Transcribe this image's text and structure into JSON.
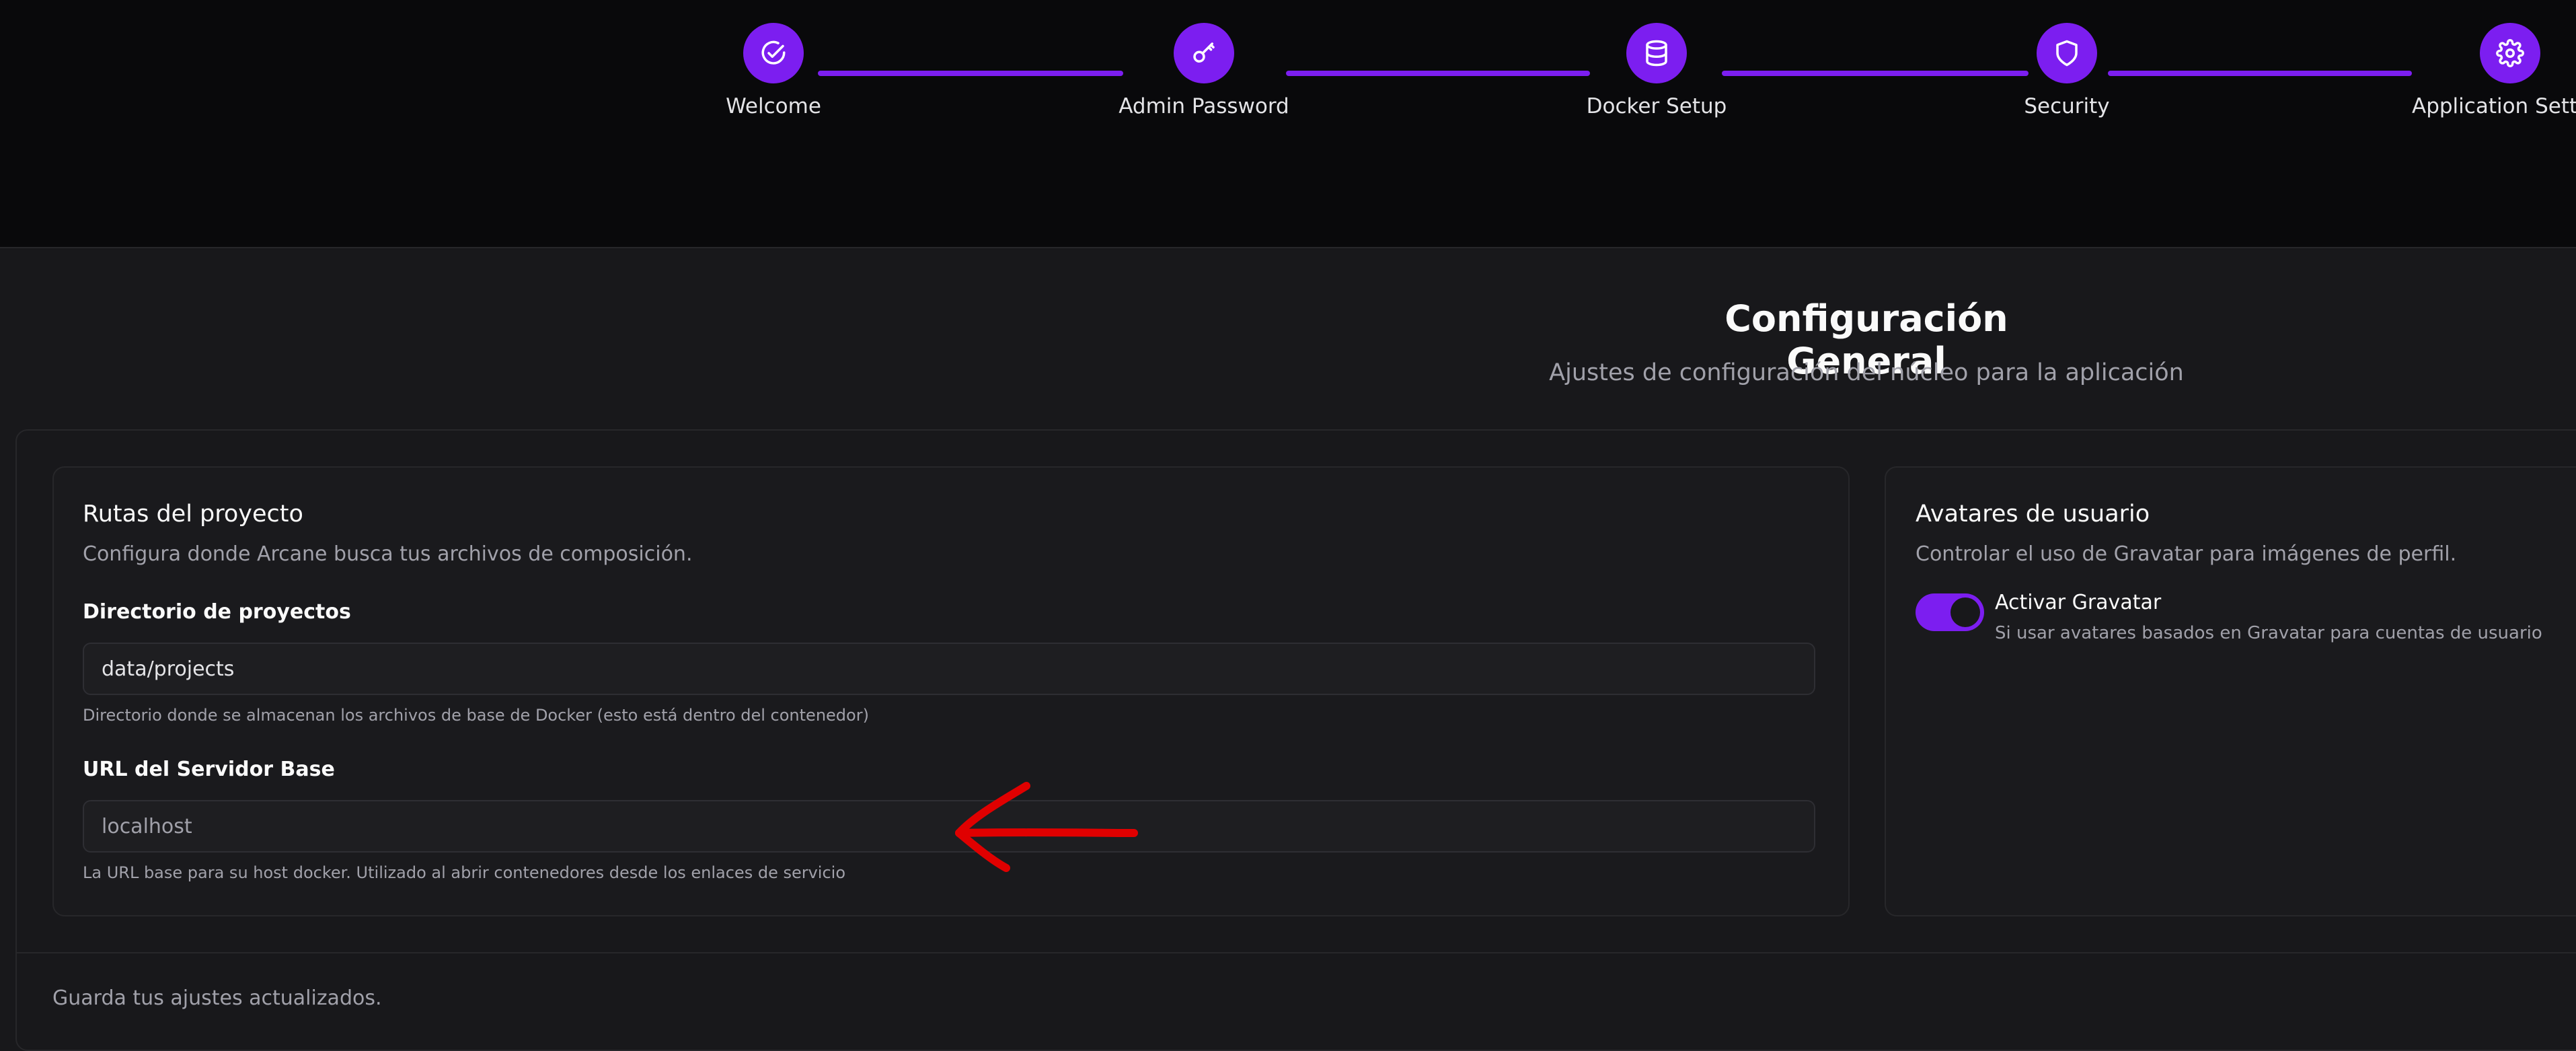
{
  "stepper": {
    "steps": [
      {
        "label": "Welcome",
        "icon": "circle-check-icon"
      },
      {
        "label": "Admin Password",
        "icon": "key-icon"
      },
      {
        "label": "Docker Setup",
        "icon": "database-icon"
      },
      {
        "label": "Security",
        "icon": "shield-icon"
      },
      {
        "label": "Application Settings",
        "icon": "gear-icon"
      }
    ],
    "accent": "#7c1ef0"
  },
  "header": {
    "title": "Configuración General",
    "subtitle": "Ajustes de configuración del núcleo para la aplicación"
  },
  "project_paths": {
    "title": "Rutas del proyecto",
    "description": "Configura donde Arcane busca tus archivos de composición.",
    "projects_dir": {
      "label": "Directorio de proyectos",
      "value": "data/projects",
      "help": "Directorio donde se almacenan los archivos de base de Docker (esto está dentro del contenedor)"
    },
    "base_url": {
      "label": "URL del Servidor Base",
      "placeholder": "localhost",
      "help": "La URL base para su host docker. Utilizado al abrir contenedores desde los enlaces de servicio"
    }
  },
  "user_avatars": {
    "title": "Avatares de usuario",
    "description": "Controlar el uso de Gravatar para imágenes de perfil.",
    "gravatar_toggle": {
      "label": "Activar Gravatar",
      "description": "Si usar avatares basados en Gravatar para cuentas de usuario",
      "enabled": true
    }
  },
  "footer": {
    "note": "Guarda tus ajustes actualizados."
  },
  "annotation": {
    "arrow_color": "#e00000"
  }
}
